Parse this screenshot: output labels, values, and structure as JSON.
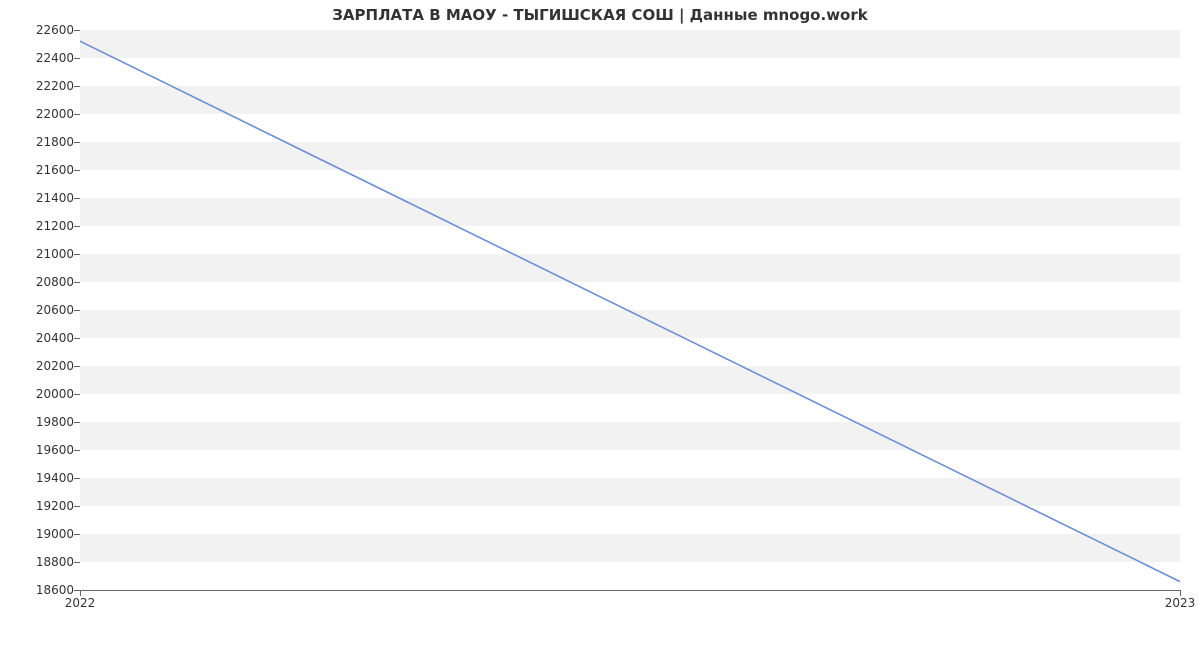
{
  "chart_data": {
    "type": "line",
    "title": "ЗАРПЛАТА В МАОУ - ТЫГИШСКАЯ СОШ | Данные mnogo.work",
    "xlabel": "",
    "ylabel": "",
    "x_categories": [
      "2022",
      "2023"
    ],
    "series": [
      {
        "name": "salary",
        "x": [
          2022,
          2023
        ],
        "y": [
          22520,
          18660
        ],
        "color": "#6b8fd6"
      }
    ],
    "y_ticks": [
      18600,
      18800,
      19000,
      19200,
      19400,
      19600,
      19800,
      20000,
      20200,
      20400,
      20600,
      20800,
      21000,
      21200,
      21400,
      21600,
      21800,
      22000,
      22200,
      22400,
      22600
    ],
    "ylim": [
      18600,
      22600
    ],
    "xlim": [
      2022,
      2023
    ],
    "band_color": "#f2f2f2"
  }
}
